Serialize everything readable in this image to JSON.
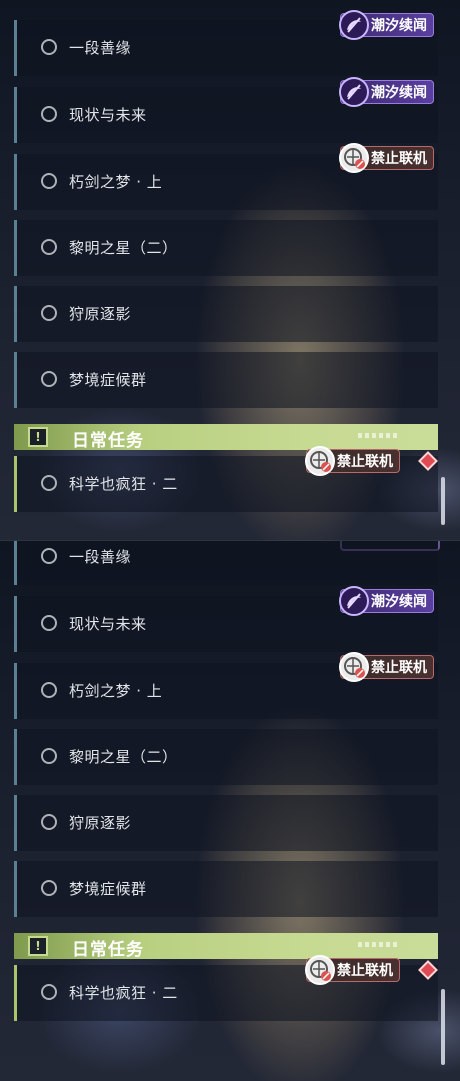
{
  "quests": [
    {
      "label": "一段善缘",
      "badge": "tide"
    },
    {
      "label": "现状与未来",
      "badge": "tide"
    },
    {
      "label": "朽剑之梦 · 上",
      "badge": "ban"
    },
    {
      "label": "黎明之星（二）",
      "badge": null
    },
    {
      "label": "狩原逐影",
      "badge": null
    },
    {
      "label": "梦境症候群",
      "badge": null
    }
  ],
  "badges": {
    "tide_label": "潮汐续闻",
    "ban_label": "禁止联机"
  },
  "daily": {
    "title": "日常任务",
    "header_icon_glyph": "!",
    "quest_label": "科学也疯狂 · 二",
    "badge_label": "禁止联机"
  },
  "icons": {
    "status": "circle-outline-icon",
    "tide": "tide-swirl-icon",
    "ban": "no-multiplayer-icon",
    "header": "alert-icon",
    "marker": "red-diamond-icon"
  },
  "colors": {
    "row_bar": "#5b7f93",
    "daily_bar": "#a9c46b",
    "daily_header": "#c7da92",
    "tide_badge": "#5a3fa0",
    "ban_badge": "#4a3030",
    "marker": "#e04a55"
  }
}
